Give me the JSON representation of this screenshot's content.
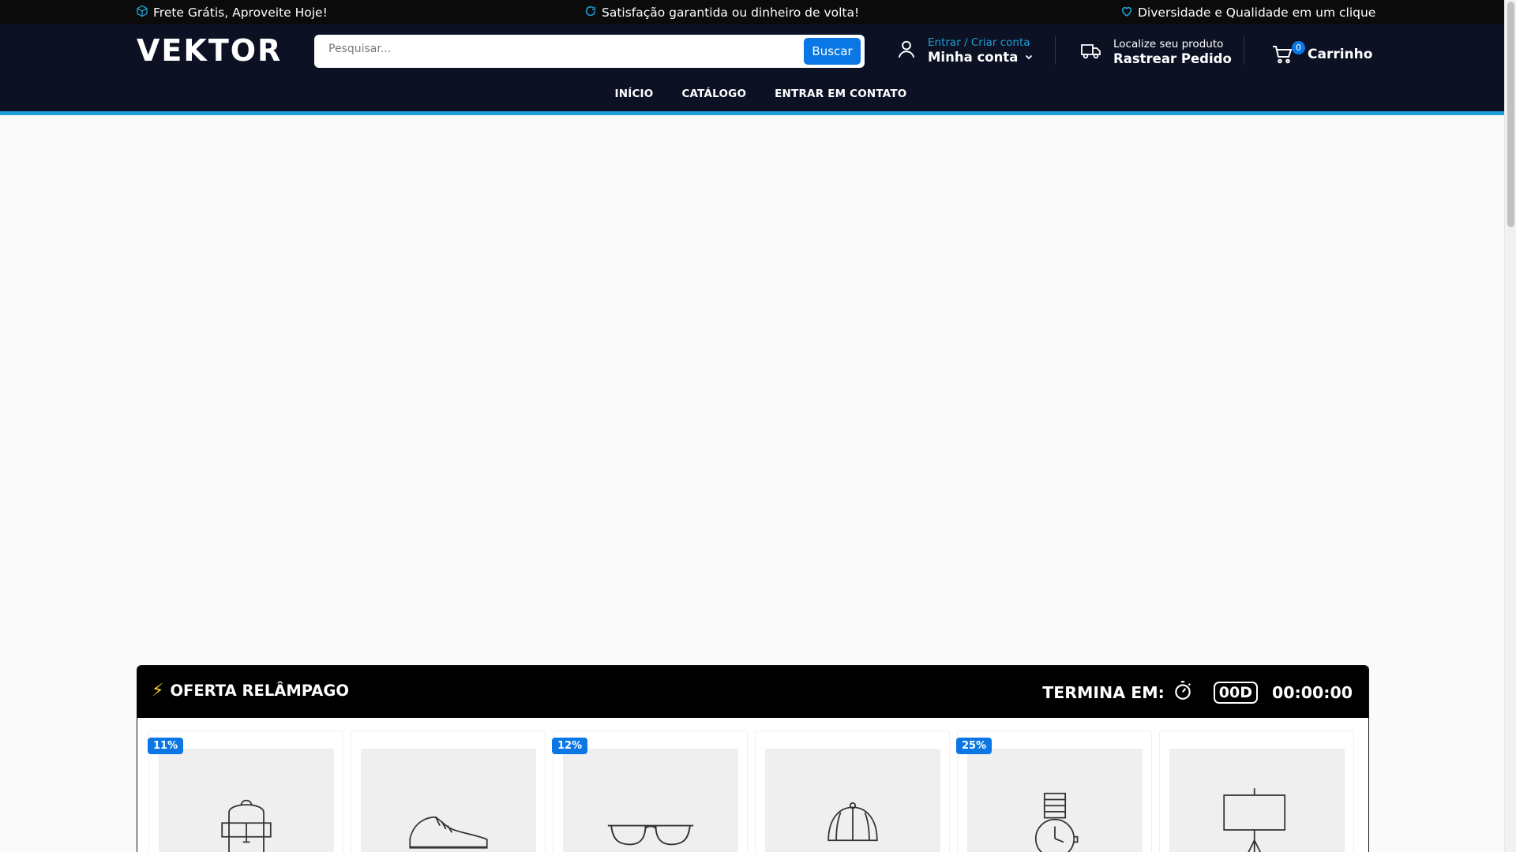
{
  "topbar": {
    "items": [
      {
        "icon": "box-icon",
        "text": "Frete Grátis, Aproveite Hoje!"
      },
      {
        "icon": "refresh-icon",
        "text": "Satisfação garantida ou dinheiro de volta!"
      },
      {
        "icon": "heart-icon",
        "text": "Diversidade e Qualidade em um clique"
      }
    ]
  },
  "header": {
    "logo": "VEKTOR",
    "search": {
      "placeholder": "Pesquisar...",
      "button": "Buscar"
    },
    "account": {
      "sub": "Entrar / Criar conta",
      "main": "Minha conta"
    },
    "track": {
      "sub": "Localize seu produto",
      "main": "Rastrear Pedido"
    },
    "cart": {
      "count": "0",
      "label": "Carrinho"
    }
  },
  "nav": {
    "links": [
      "INÍCIO",
      "CATÁLOGO",
      "ENTRAR EM CONTATO"
    ]
  },
  "flash_sale": {
    "title": "OFERTA RELÂMPAGO",
    "ends_label": "TERMINA EM:",
    "days": "00D",
    "time": "00:00:00",
    "products": [
      {
        "discount": "11%",
        "icon": "backpack-icon"
      },
      {
        "discount": "",
        "icon": "sneaker-icon"
      },
      {
        "discount": "12%",
        "icon": "sunglasses-icon"
      },
      {
        "discount": "",
        "icon": "cap-icon"
      },
      {
        "discount": "25%",
        "icon": "watch-icon"
      },
      {
        "discount": "",
        "icon": "lamp-icon"
      }
    ]
  },
  "colors": {
    "topbar": "#0b0b0b",
    "header": "#0c1224",
    "accent": "#1e9fd6",
    "primary": "#0a77e5"
  }
}
